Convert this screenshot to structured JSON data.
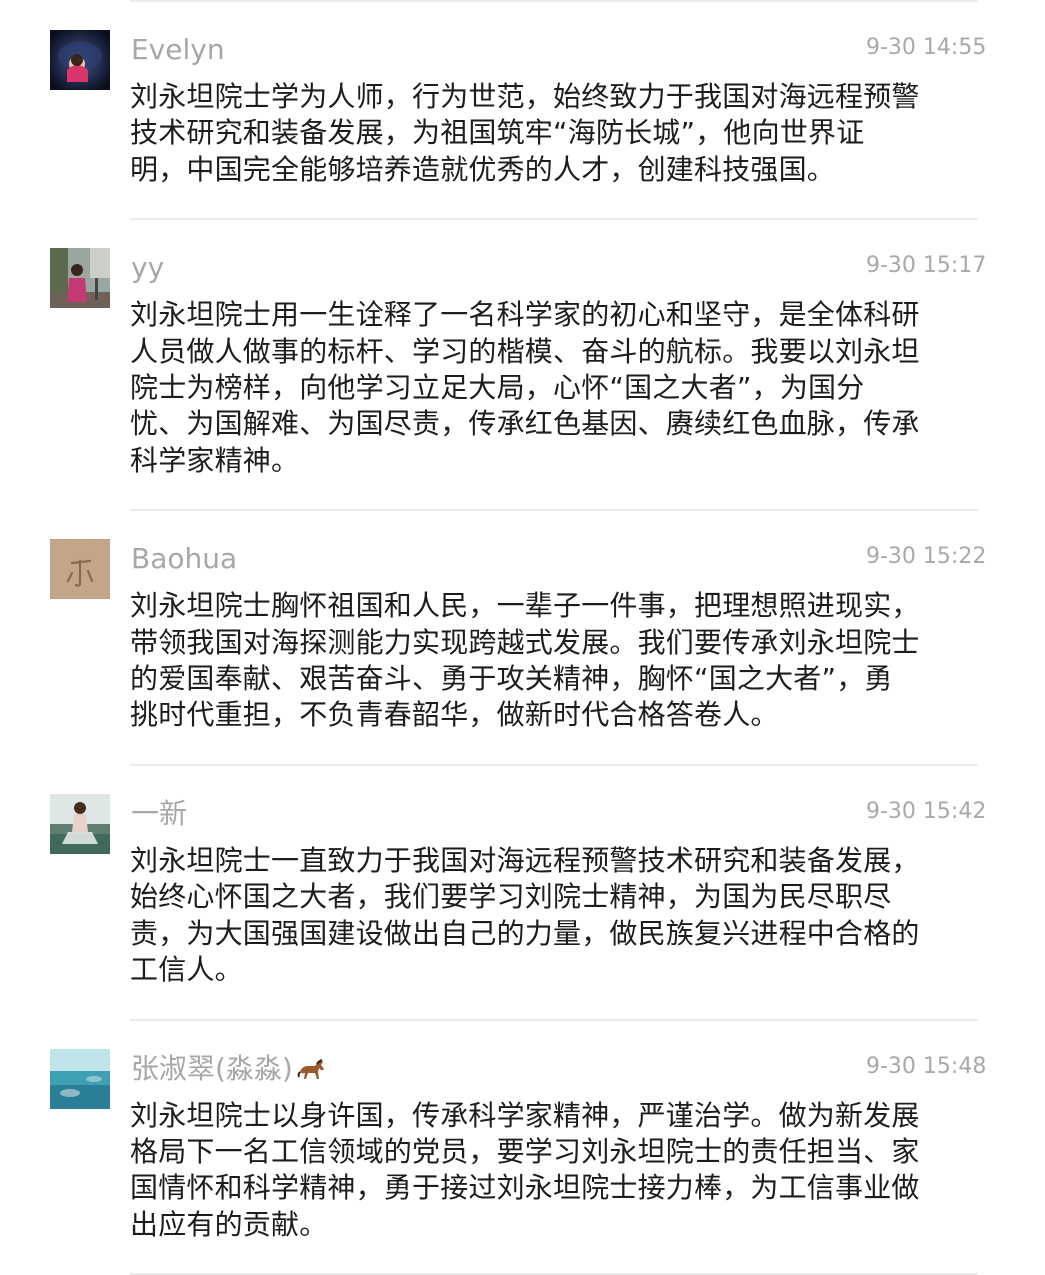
{
  "comments": [
    {
      "name": "Evelyn",
      "time": "9-30 14:55",
      "text": "刘永坦院士学为人师，行为世范，始终致力于我国对海远程预警技术研究和装备发展，为祖国筑牢“海防长城”，他向世界证明，中国完全能够培养造就优秀的人才，创建科技强国。",
      "avatar": "avatar-evelyn"
    },
    {
      "name": "yy",
      "time": "9-30 15:17",
      "text": "刘永坦院士用一生诠释了一名科学家的初心和坚守，是全体科研人员做人做事的标杆、学习的楷模、奋斗的航标。我要以刘永坦院士为榜样，向他学习立足大局，心怀“国之大者”，为国分忧、为国解难、为国尽责，传承红色基因、赓续红色血脉，传承科学家精神。",
      "avatar": "avatar-yy"
    },
    {
      "name": "Baohua",
      "time": "9-30 15:22",
      "text": "刘永坦院士胸怀祖国和人民，一辈子一件事，把理想照进现实，带领我国对海探测能力实现跨越式发展。我们要传承刘永坦院士的爱国奉献、艰苦奋斗、勇于攻关精神，胸怀“国之大者”，勇挑时代重担，不负青春韶华，做新时代合格答卷人。",
      "avatar": "avatar-baohua"
    },
    {
      "name": "一新",
      "time": "9-30 15:42",
      "text": "刘永坦院士一直致力于我国对海远程预警技术研究和装备发展，始终心怀国之大者，我们要学习刘院士精神，为国为民尽职尽责，为大国强国建设做出自己的力量，做民族复兴进程中合格的工信人。",
      "avatar": "avatar-yixin"
    },
    {
      "name": "张淑翠(淼淼)",
      "time": "9-30 15:48",
      "text": "刘永坦院士以身许国，传承科学家精神，严谨治学。做为新发展格局下一名工信领域的党员，要学习刘永坦院士的责任担当、家国情怀和科学精神，勇于接过刘永坦院士接力棒，为工信事业做出应有的贡献。",
      "avatar": "avatar-zhang",
      "name_icon": "horse-icon"
    }
  ]
}
